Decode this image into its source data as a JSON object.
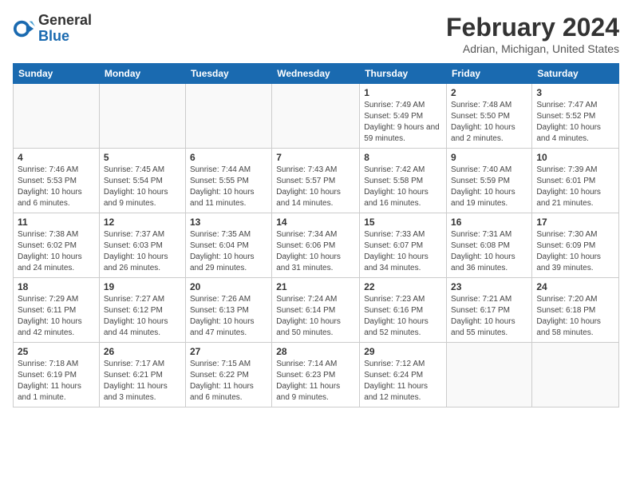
{
  "header": {
    "logo_general": "General",
    "logo_blue": "Blue",
    "month_year": "February 2024",
    "location": "Adrian, Michigan, United States"
  },
  "weekdays": [
    "Sunday",
    "Monday",
    "Tuesday",
    "Wednesday",
    "Thursday",
    "Friday",
    "Saturday"
  ],
  "weeks": [
    [
      {
        "day": "",
        "info": ""
      },
      {
        "day": "",
        "info": ""
      },
      {
        "day": "",
        "info": ""
      },
      {
        "day": "",
        "info": ""
      },
      {
        "day": "1",
        "info": "Sunrise: 7:49 AM\nSunset: 5:49 PM\nDaylight: 9 hours and 59 minutes."
      },
      {
        "day": "2",
        "info": "Sunrise: 7:48 AM\nSunset: 5:50 PM\nDaylight: 10 hours and 2 minutes."
      },
      {
        "day": "3",
        "info": "Sunrise: 7:47 AM\nSunset: 5:52 PM\nDaylight: 10 hours and 4 minutes."
      }
    ],
    [
      {
        "day": "4",
        "info": "Sunrise: 7:46 AM\nSunset: 5:53 PM\nDaylight: 10 hours and 6 minutes."
      },
      {
        "day": "5",
        "info": "Sunrise: 7:45 AM\nSunset: 5:54 PM\nDaylight: 10 hours and 9 minutes."
      },
      {
        "day": "6",
        "info": "Sunrise: 7:44 AM\nSunset: 5:55 PM\nDaylight: 10 hours and 11 minutes."
      },
      {
        "day": "7",
        "info": "Sunrise: 7:43 AM\nSunset: 5:57 PM\nDaylight: 10 hours and 14 minutes."
      },
      {
        "day": "8",
        "info": "Sunrise: 7:42 AM\nSunset: 5:58 PM\nDaylight: 10 hours and 16 minutes."
      },
      {
        "day": "9",
        "info": "Sunrise: 7:40 AM\nSunset: 5:59 PM\nDaylight: 10 hours and 19 minutes."
      },
      {
        "day": "10",
        "info": "Sunrise: 7:39 AM\nSunset: 6:01 PM\nDaylight: 10 hours and 21 minutes."
      }
    ],
    [
      {
        "day": "11",
        "info": "Sunrise: 7:38 AM\nSunset: 6:02 PM\nDaylight: 10 hours and 24 minutes."
      },
      {
        "day": "12",
        "info": "Sunrise: 7:37 AM\nSunset: 6:03 PM\nDaylight: 10 hours and 26 minutes."
      },
      {
        "day": "13",
        "info": "Sunrise: 7:35 AM\nSunset: 6:04 PM\nDaylight: 10 hours and 29 minutes."
      },
      {
        "day": "14",
        "info": "Sunrise: 7:34 AM\nSunset: 6:06 PM\nDaylight: 10 hours and 31 minutes."
      },
      {
        "day": "15",
        "info": "Sunrise: 7:33 AM\nSunset: 6:07 PM\nDaylight: 10 hours and 34 minutes."
      },
      {
        "day": "16",
        "info": "Sunrise: 7:31 AM\nSunset: 6:08 PM\nDaylight: 10 hours and 36 minutes."
      },
      {
        "day": "17",
        "info": "Sunrise: 7:30 AM\nSunset: 6:09 PM\nDaylight: 10 hours and 39 minutes."
      }
    ],
    [
      {
        "day": "18",
        "info": "Sunrise: 7:29 AM\nSunset: 6:11 PM\nDaylight: 10 hours and 42 minutes."
      },
      {
        "day": "19",
        "info": "Sunrise: 7:27 AM\nSunset: 6:12 PM\nDaylight: 10 hours and 44 minutes."
      },
      {
        "day": "20",
        "info": "Sunrise: 7:26 AM\nSunset: 6:13 PM\nDaylight: 10 hours and 47 minutes."
      },
      {
        "day": "21",
        "info": "Sunrise: 7:24 AM\nSunset: 6:14 PM\nDaylight: 10 hours and 50 minutes."
      },
      {
        "day": "22",
        "info": "Sunrise: 7:23 AM\nSunset: 6:16 PM\nDaylight: 10 hours and 52 minutes."
      },
      {
        "day": "23",
        "info": "Sunrise: 7:21 AM\nSunset: 6:17 PM\nDaylight: 10 hours and 55 minutes."
      },
      {
        "day": "24",
        "info": "Sunrise: 7:20 AM\nSunset: 6:18 PM\nDaylight: 10 hours and 58 minutes."
      }
    ],
    [
      {
        "day": "25",
        "info": "Sunrise: 7:18 AM\nSunset: 6:19 PM\nDaylight: 11 hours and 1 minute."
      },
      {
        "day": "26",
        "info": "Sunrise: 7:17 AM\nSunset: 6:21 PM\nDaylight: 11 hours and 3 minutes."
      },
      {
        "day": "27",
        "info": "Sunrise: 7:15 AM\nSunset: 6:22 PM\nDaylight: 11 hours and 6 minutes."
      },
      {
        "day": "28",
        "info": "Sunrise: 7:14 AM\nSunset: 6:23 PM\nDaylight: 11 hours and 9 minutes."
      },
      {
        "day": "29",
        "info": "Sunrise: 7:12 AM\nSunset: 6:24 PM\nDaylight: 11 hours and 12 minutes."
      },
      {
        "day": "",
        "info": ""
      },
      {
        "day": "",
        "info": ""
      }
    ]
  ]
}
